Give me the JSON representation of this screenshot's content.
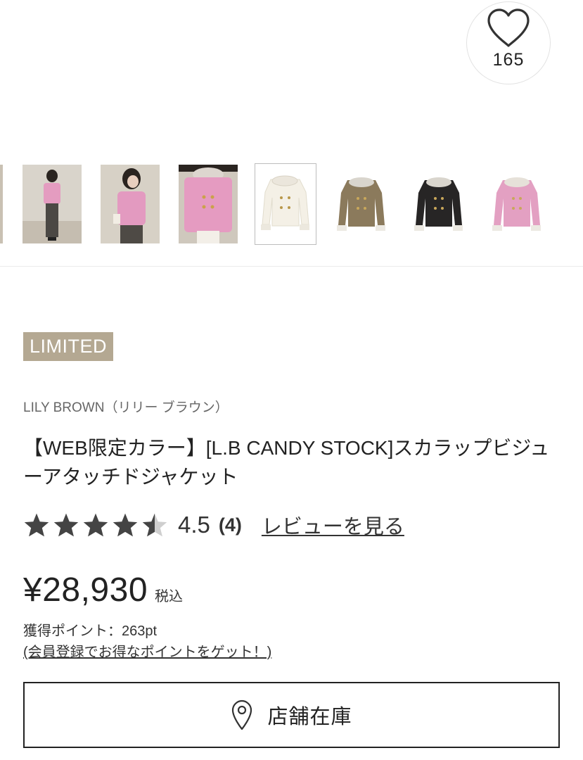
{
  "favorite": {
    "count": "165",
    "icon": "heart-outline-icon"
  },
  "gallery": {
    "selected_index": 4,
    "items": [
      "model-full-body-pink",
      "model-half-body-pink",
      "model-closeup-pink",
      "jacket-ivory",
      "jacket-brown",
      "jacket-black",
      "jacket-pink"
    ]
  },
  "product": {
    "badge": "LIMITED",
    "brand": "LILY BROWN（リリー ブラウン）",
    "title": "【WEB限定カラー】[L.B CANDY STOCK]スカラップビジューアタッチドジャケット",
    "rating": {
      "value": "4.5",
      "count": "(4)",
      "stars": 4.5,
      "review_link": "レビューを見る"
    },
    "price": {
      "value": "¥28,930",
      "tax_label": "税込"
    },
    "points": "獲得ポイント：263pt",
    "points_link": "(会員登録でお得なポイントをゲット！)"
  },
  "store_stock": {
    "label": "店舗在庫",
    "icon": "map-pin-icon"
  },
  "colors": {
    "badge_bg": "#b4a892",
    "star": "#444444",
    "star_empty": "#cfcfcf",
    "border": "#222222"
  }
}
